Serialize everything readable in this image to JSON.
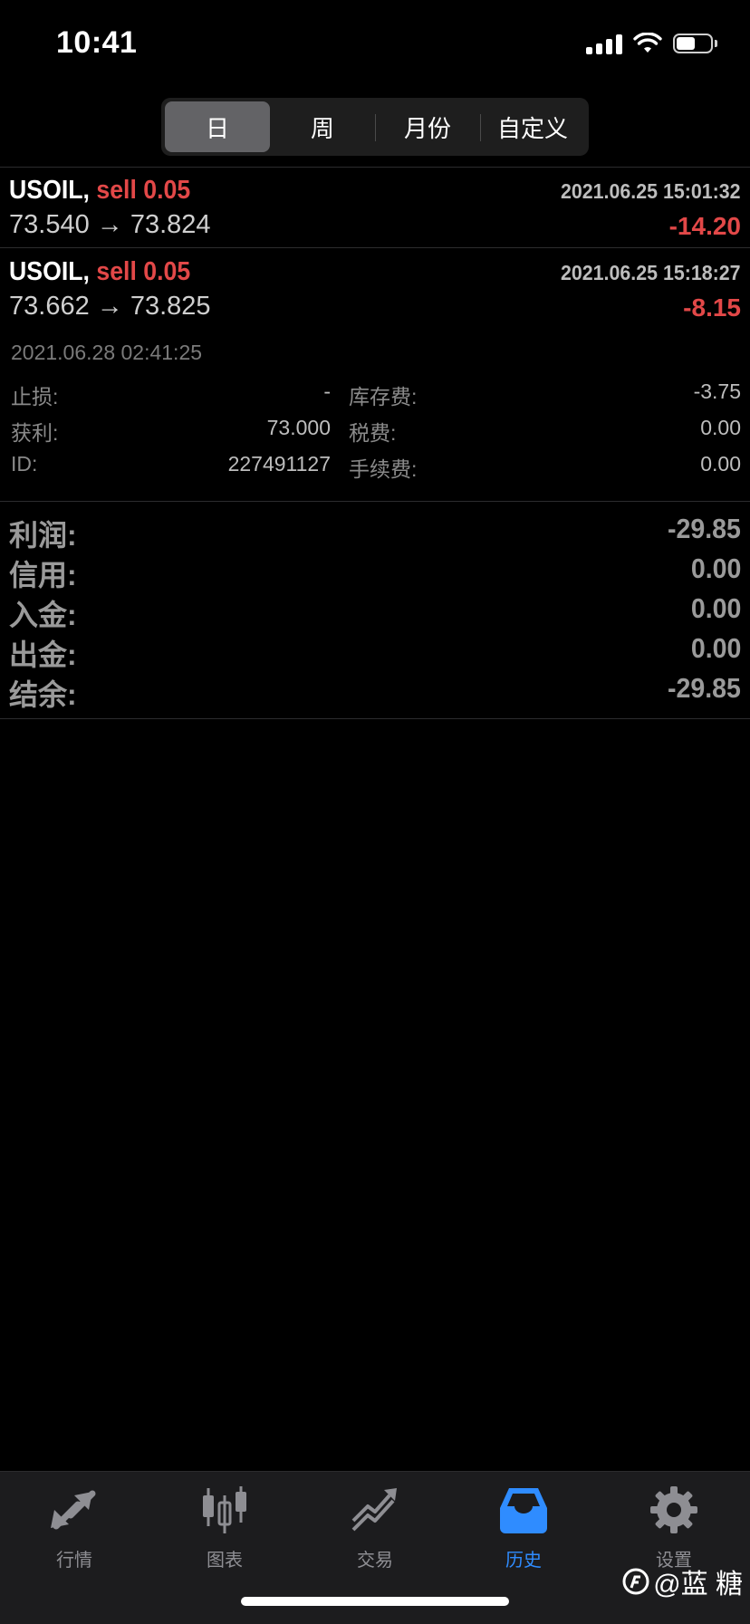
{
  "status_bar": {
    "time": "10:41"
  },
  "segment": {
    "items": [
      {
        "label": "日",
        "active": true
      },
      {
        "label": "周",
        "active": false
      },
      {
        "label": "月份",
        "active": false
      },
      {
        "label": "自定义",
        "active": false
      }
    ]
  },
  "deals": [
    {
      "symbol": "USOIL,",
      "side": "sell 0.05",
      "datetime": "2021.06.25 15:01:32",
      "prices": "73.540 → 73.824",
      "profit": "-14.20"
    },
    {
      "symbol": "USOIL,",
      "side": "sell 0.05",
      "datetime": "2021.06.25 15:18:27",
      "prices": "73.662 → 73.825",
      "profit": "-8.15"
    }
  ],
  "detail": {
    "date": "2021.06.28 02:41:25",
    "rows": [
      {
        "l1": "止损:",
        "v1": "-",
        "l2": "库存费:",
        "v2": "-3.75"
      },
      {
        "l1": "获利:",
        "v1": "73.000",
        "l2": "税费:",
        "v2": "0.00"
      },
      {
        "l1": "ID:",
        "v1": "227491127",
        "l2": "手续费:",
        "v2": "0.00"
      }
    ]
  },
  "summary": [
    {
      "label": "利润:",
      "value": "-29.85"
    },
    {
      "label": "信用:",
      "value": "0.00"
    },
    {
      "label": "入金:",
      "value": "0.00"
    },
    {
      "label": "出金:",
      "value": "0.00"
    },
    {
      "label": "结余:",
      "value": "-29.85"
    }
  ],
  "tabbar": {
    "items": [
      {
        "label": "行情",
        "icon": "quotes-arrows-icon"
      },
      {
        "label": "图表",
        "icon": "candlestick-chart-icon"
      },
      {
        "label": "交易",
        "icon": "trade-trend-icon"
      },
      {
        "label": "历史",
        "icon": "history-inbox-icon",
        "active": true
      },
      {
        "label": "设置",
        "icon": "gear-icon"
      }
    ]
  },
  "watermark": {
    "text": "@蓝  糖"
  },
  "colors": {
    "negative": "#e24848",
    "accent": "#2f8cff",
    "background": "#000000"
  }
}
